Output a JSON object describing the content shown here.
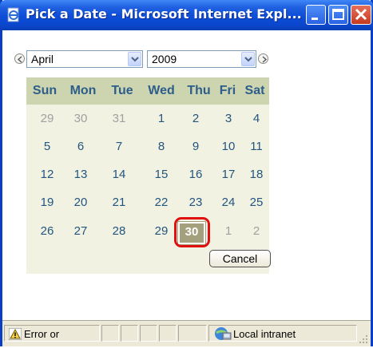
{
  "window": {
    "title": "Pick a Date - Microsoft Internet Expl...",
    "buttons": [
      "minimize",
      "maximize",
      "close"
    ]
  },
  "picker": {
    "month": "April",
    "year": "2009",
    "prev_icon": "chevron-left-icon",
    "next_icon": "chevron-right-icon"
  },
  "calendar": {
    "weekdays": [
      "Sun",
      "Mon",
      "Tue",
      "Wed",
      "Thu",
      "Fri",
      "Sat"
    ],
    "weeks": [
      [
        "29",
        "30",
        "31",
        "1",
        "2",
        "3",
        "4"
      ],
      [
        "5",
        "6",
        "7",
        "8",
        "9",
        "10",
        "11"
      ],
      [
        "12",
        "13",
        "14",
        "15",
        "16",
        "17",
        "18"
      ],
      [
        "19",
        "20",
        "21",
        "22",
        "23",
        "24",
        "25"
      ],
      [
        "26",
        "27",
        "28",
        "29",
        "30",
        "1",
        "2"
      ]
    ],
    "selected_day": "30",
    "colors": {
      "header_bg": "#cdd5b0",
      "body_bg": "#f1f2e2",
      "day_text": "#23557f",
      "other_month_text": "#a0a0a0",
      "selected_bg": "#a4a07d",
      "highlight_ring": "#e01010"
    }
  },
  "cancel_button": {
    "label": "Cancel"
  },
  "statusbar": {
    "message": "Error or",
    "zone": "Local intranet"
  }
}
